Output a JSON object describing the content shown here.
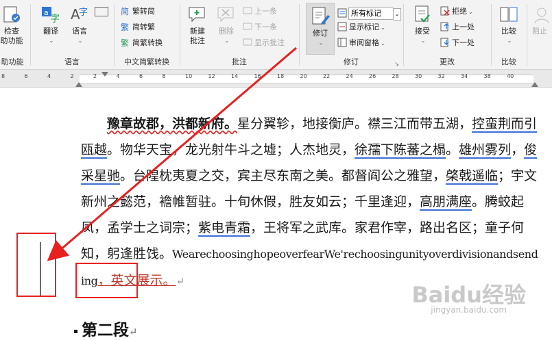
{
  "ribbon": {
    "accessibility": {
      "line1": "检查",
      "line2": "助功能",
      "group": "助功能"
    },
    "language": {
      "translate": "翻译",
      "language": "语言",
      "group": "语言"
    },
    "chinese": {
      "to_simplified": "繁转简",
      "to_traditional": "简转繁",
      "convert": "简繁转换",
      "group": "中文简繁转换"
    },
    "comments": {
      "new_line1": "新建",
      "new_line2": "批注",
      "delete": "删除",
      "previous": "上一条",
      "next": "下一条",
      "show": "显示批注",
      "group": "批注"
    },
    "tracking": {
      "track": "修订",
      "markup_select": "所有标记",
      "show_markup": "显示标记",
      "review_pane": "审阅窗格",
      "group": "修订"
    },
    "changes": {
      "accept": "接受",
      "reject": "拒绝",
      "previous": "上一处",
      "next": "下一处",
      "group": "更改"
    },
    "compare": {
      "compare": "比较",
      "group": "比较"
    },
    "protect": {
      "block": "阻止"
    }
  },
  "ruler": {
    "numbers": [
      "8",
      "6",
      "4",
      "2",
      "2",
      "4",
      "6",
      "8",
      "10",
      "12",
      "14",
      "16",
      "18",
      "20",
      "22",
      "24",
      "26",
      "28",
      "30",
      "32",
      "34",
      "38",
      "40"
    ]
  },
  "document": {
    "bold_title": "豫章故郡，洪都新府。",
    "p1": "星分翼轸，地接衡庐。襟三江而带五湖，",
    "p1_u": "控蛮荆而引瓯越",
    "p2": "。物华天宝，龙光射牛斗之墟；人杰地灵，",
    "p2_u": "徐孺下陈蕃之榻",
    "p3": "。",
    "p3_u": "雄州雾列",
    "p4": "，",
    "p4_u": "俊采星驰",
    "p5": "。台隍枕夷夏之交，宾主尽东南之美。都督阎公之雅望，",
    "p5_u": "棨戟遥临",
    "p6": "；宇文新州之懿范，襜帷暂驻。十旬休假，胜友如云；千里逢迎，",
    "p6_u": "高朋满座",
    "p7": "。腾蛟起凤，孟学士之词宗；",
    "p7_u": "紫电青霜",
    "p8": "，王将军之武库。家君作宰，路出名区；童子何知，躬逢胜饯。",
    "english": "WearechoosinghopeoverfearWe'rechoosingunityoverdivisionandsending",
    "inserted": "，英文展示。",
    "heading": "第二段"
  },
  "watermark": {
    "brand": "Baidu经验",
    "url": "jingyan.baidu.com"
  },
  "colors": {
    "annotation_red": "#e82020",
    "inserted_text": "#c0392b",
    "ribbon_bg": "#f3f3f3"
  }
}
